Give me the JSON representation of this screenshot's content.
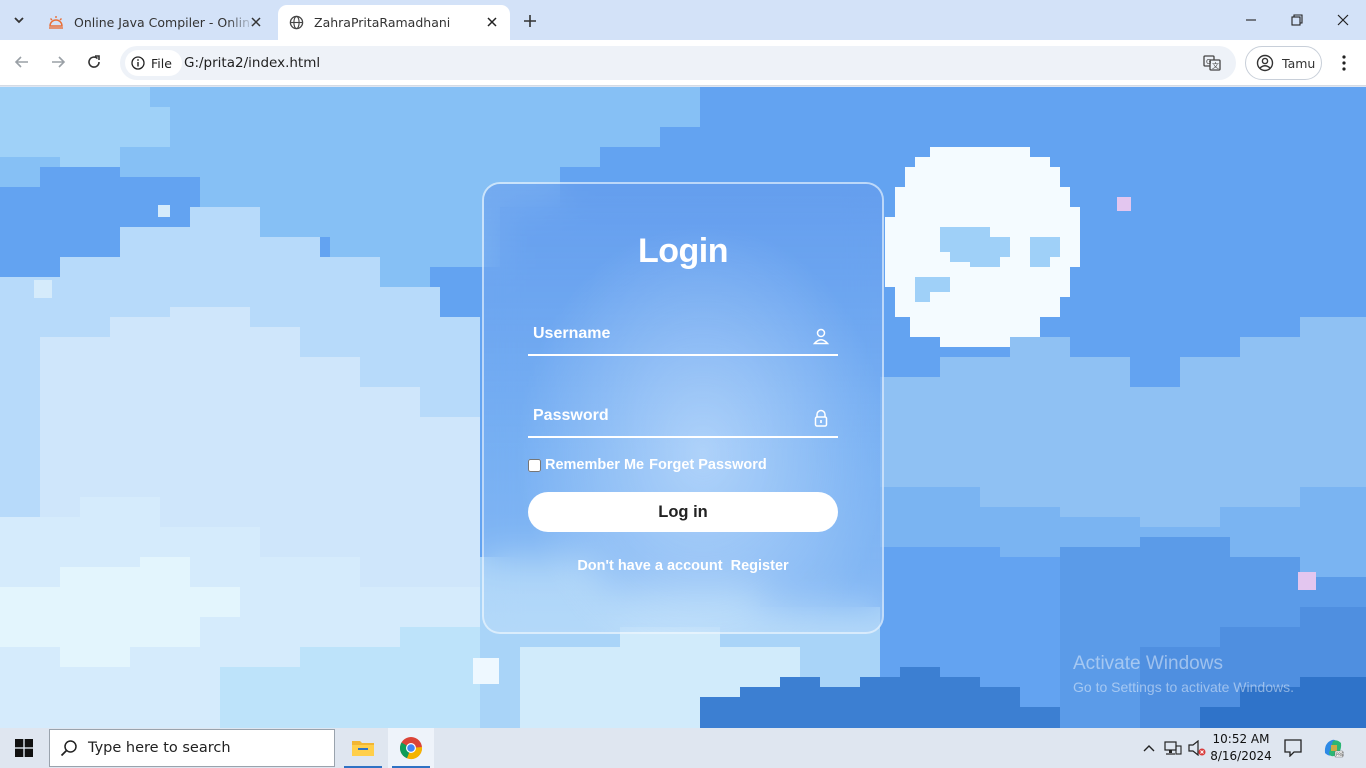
{
  "browser": {
    "tabs": [
      {
        "title": "Online Java Compiler - Online J",
        "icon": "sun-logo-icon",
        "active": false
      },
      {
        "title": "ZahraPritaRamadhani",
        "icon": "globe-icon",
        "active": true
      }
    ],
    "address": {
      "chip_label": "File",
      "url": "G:/prita2/index.html"
    },
    "profile_label": "Tamu"
  },
  "login": {
    "title": "Login",
    "username_placeholder": "Username",
    "password_placeholder": "Password",
    "remember_label": "Remember Me",
    "forget_label": "Forget Password",
    "button_label": "Log in",
    "register_prompt": "Don't have a account",
    "register_link": "Register"
  },
  "watermark": {
    "line1": "Activate Windows",
    "line2": "Go to Settings to activate Windows."
  },
  "taskbar": {
    "search_placeholder": "Type here to search",
    "time": "10:52 AM",
    "date": "8/16/2024"
  },
  "colors": {
    "sky": "#63a3f1",
    "card_border": "#ffffff",
    "button_bg": "#ffffff"
  }
}
